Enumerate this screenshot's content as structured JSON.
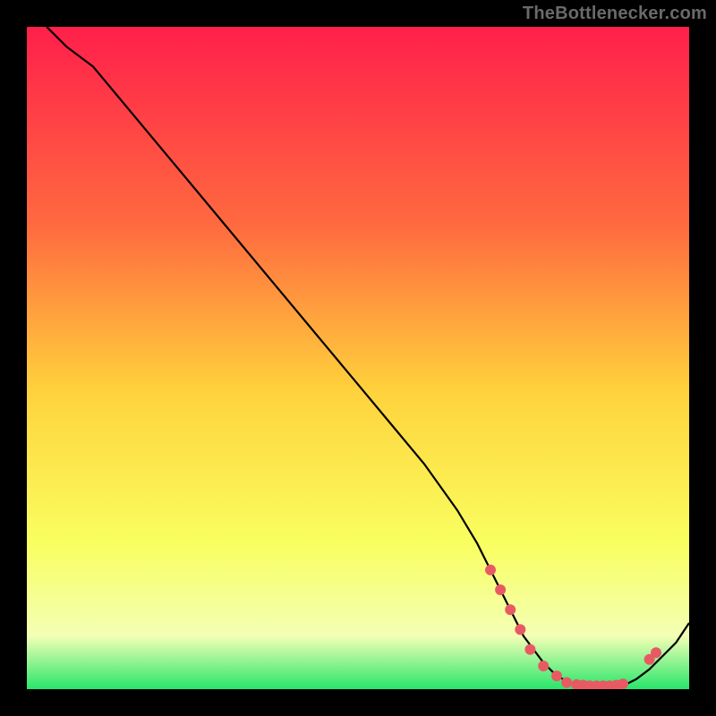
{
  "attribution": "TheBottlenecker.com",
  "colors": {
    "gradient_top": "#ff1f4b",
    "gradient_mid_upper": "#ff6a3f",
    "gradient_mid": "#ffd23c",
    "gradient_lower": "#f9ff60",
    "gradient_pale": "#f3ffb5",
    "gradient_green": "#28e66b",
    "line": "#000000",
    "marker": "#e85a63",
    "frame": "#000000"
  },
  "chart_data": {
    "type": "line",
    "title": "",
    "xlabel": "",
    "ylabel": "",
    "xlim": [
      0,
      100
    ],
    "ylim": [
      0,
      100
    ],
    "series": [
      {
        "name": "bottleneck-curve",
        "x": [
          3,
          6,
          10,
          15,
          20,
          25,
          30,
          35,
          40,
          45,
          50,
          55,
          60,
          65,
          68,
          70,
          73,
          75,
          78,
          80,
          82,
          84,
          86,
          88,
          90,
          92,
          94,
          96,
          98,
          100
        ],
        "y": [
          100,
          97,
          94,
          88,
          82,
          76,
          70,
          64,
          58,
          52,
          46,
          40,
          34,
          27,
          22,
          18,
          12,
          8,
          4,
          2,
          1,
          0.5,
          0.5,
          0.5,
          0.5,
          1.5,
          3,
          5,
          7,
          10
        ]
      }
    ],
    "markers": {
      "name": "highlight-dots",
      "points": [
        {
          "x": 70,
          "y": 18
        },
        {
          "x": 71.5,
          "y": 15
        },
        {
          "x": 73,
          "y": 12
        },
        {
          "x": 74.5,
          "y": 9
        },
        {
          "x": 76,
          "y": 6
        },
        {
          "x": 78,
          "y": 3.5
        },
        {
          "x": 80,
          "y": 2
        },
        {
          "x": 81.5,
          "y": 1
        },
        {
          "x": 83,
          "y": 0.7
        },
        {
          "x": 84,
          "y": 0.6
        },
        {
          "x": 85,
          "y": 0.5
        },
        {
          "x": 86,
          "y": 0.5
        },
        {
          "x": 87,
          "y": 0.5
        },
        {
          "x": 88,
          "y": 0.5
        },
        {
          "x": 89,
          "y": 0.6
        },
        {
          "x": 90,
          "y": 0.8
        },
        {
          "x": 94,
          "y": 4.5
        },
        {
          "x": 95,
          "y": 5.5
        }
      ]
    },
    "gradient_stops": [
      {
        "offset": 0.0,
        "key": "gradient_top"
      },
      {
        "offset": 0.3,
        "key": "gradient_mid_upper"
      },
      {
        "offset": 0.55,
        "key": "gradient_mid"
      },
      {
        "offset": 0.78,
        "key": "gradient_lower"
      },
      {
        "offset": 0.92,
        "key": "gradient_pale"
      },
      {
        "offset": 1.0,
        "key": "gradient_green"
      }
    ]
  }
}
